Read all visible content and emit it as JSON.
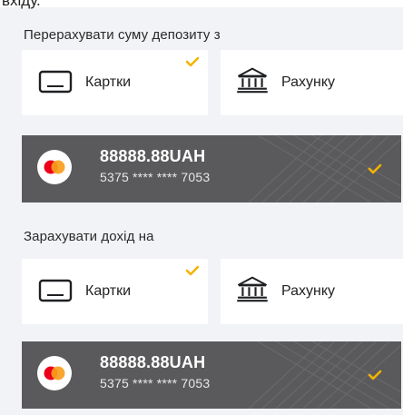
{
  "top_fragment": "вхіду.",
  "source_section": {
    "title": "Перерахувати суму депозиту з",
    "options": [
      {
        "label": "Картки",
        "icon": "card-icon",
        "selected": true
      },
      {
        "label": "Рахунку",
        "icon": "bank-icon",
        "selected": false
      }
    ],
    "card": {
      "amount": "88888.88UAH",
      "number": "5375 **** **** 7053",
      "logo": "mastercard-logo",
      "selected": true
    }
  },
  "destination_section": {
    "title": "Зарахувати дохід на",
    "options": [
      {
        "label": "Картки",
        "icon": "card-icon",
        "selected": true
      },
      {
        "label": "Рахунку",
        "icon": "bank-icon",
        "selected": false
      }
    ],
    "card": {
      "amount": "88888.88UAH",
      "number": "5375 **** **** 7053",
      "logo": "mastercard-logo",
      "selected": true
    }
  },
  "colors": {
    "background": "#f1f3f7",
    "card_panel": "#5a5a5c",
    "accent_check": "#f4b400",
    "mastercard_red": "#eb001b",
    "mastercard_yellow": "#f79e1b"
  }
}
